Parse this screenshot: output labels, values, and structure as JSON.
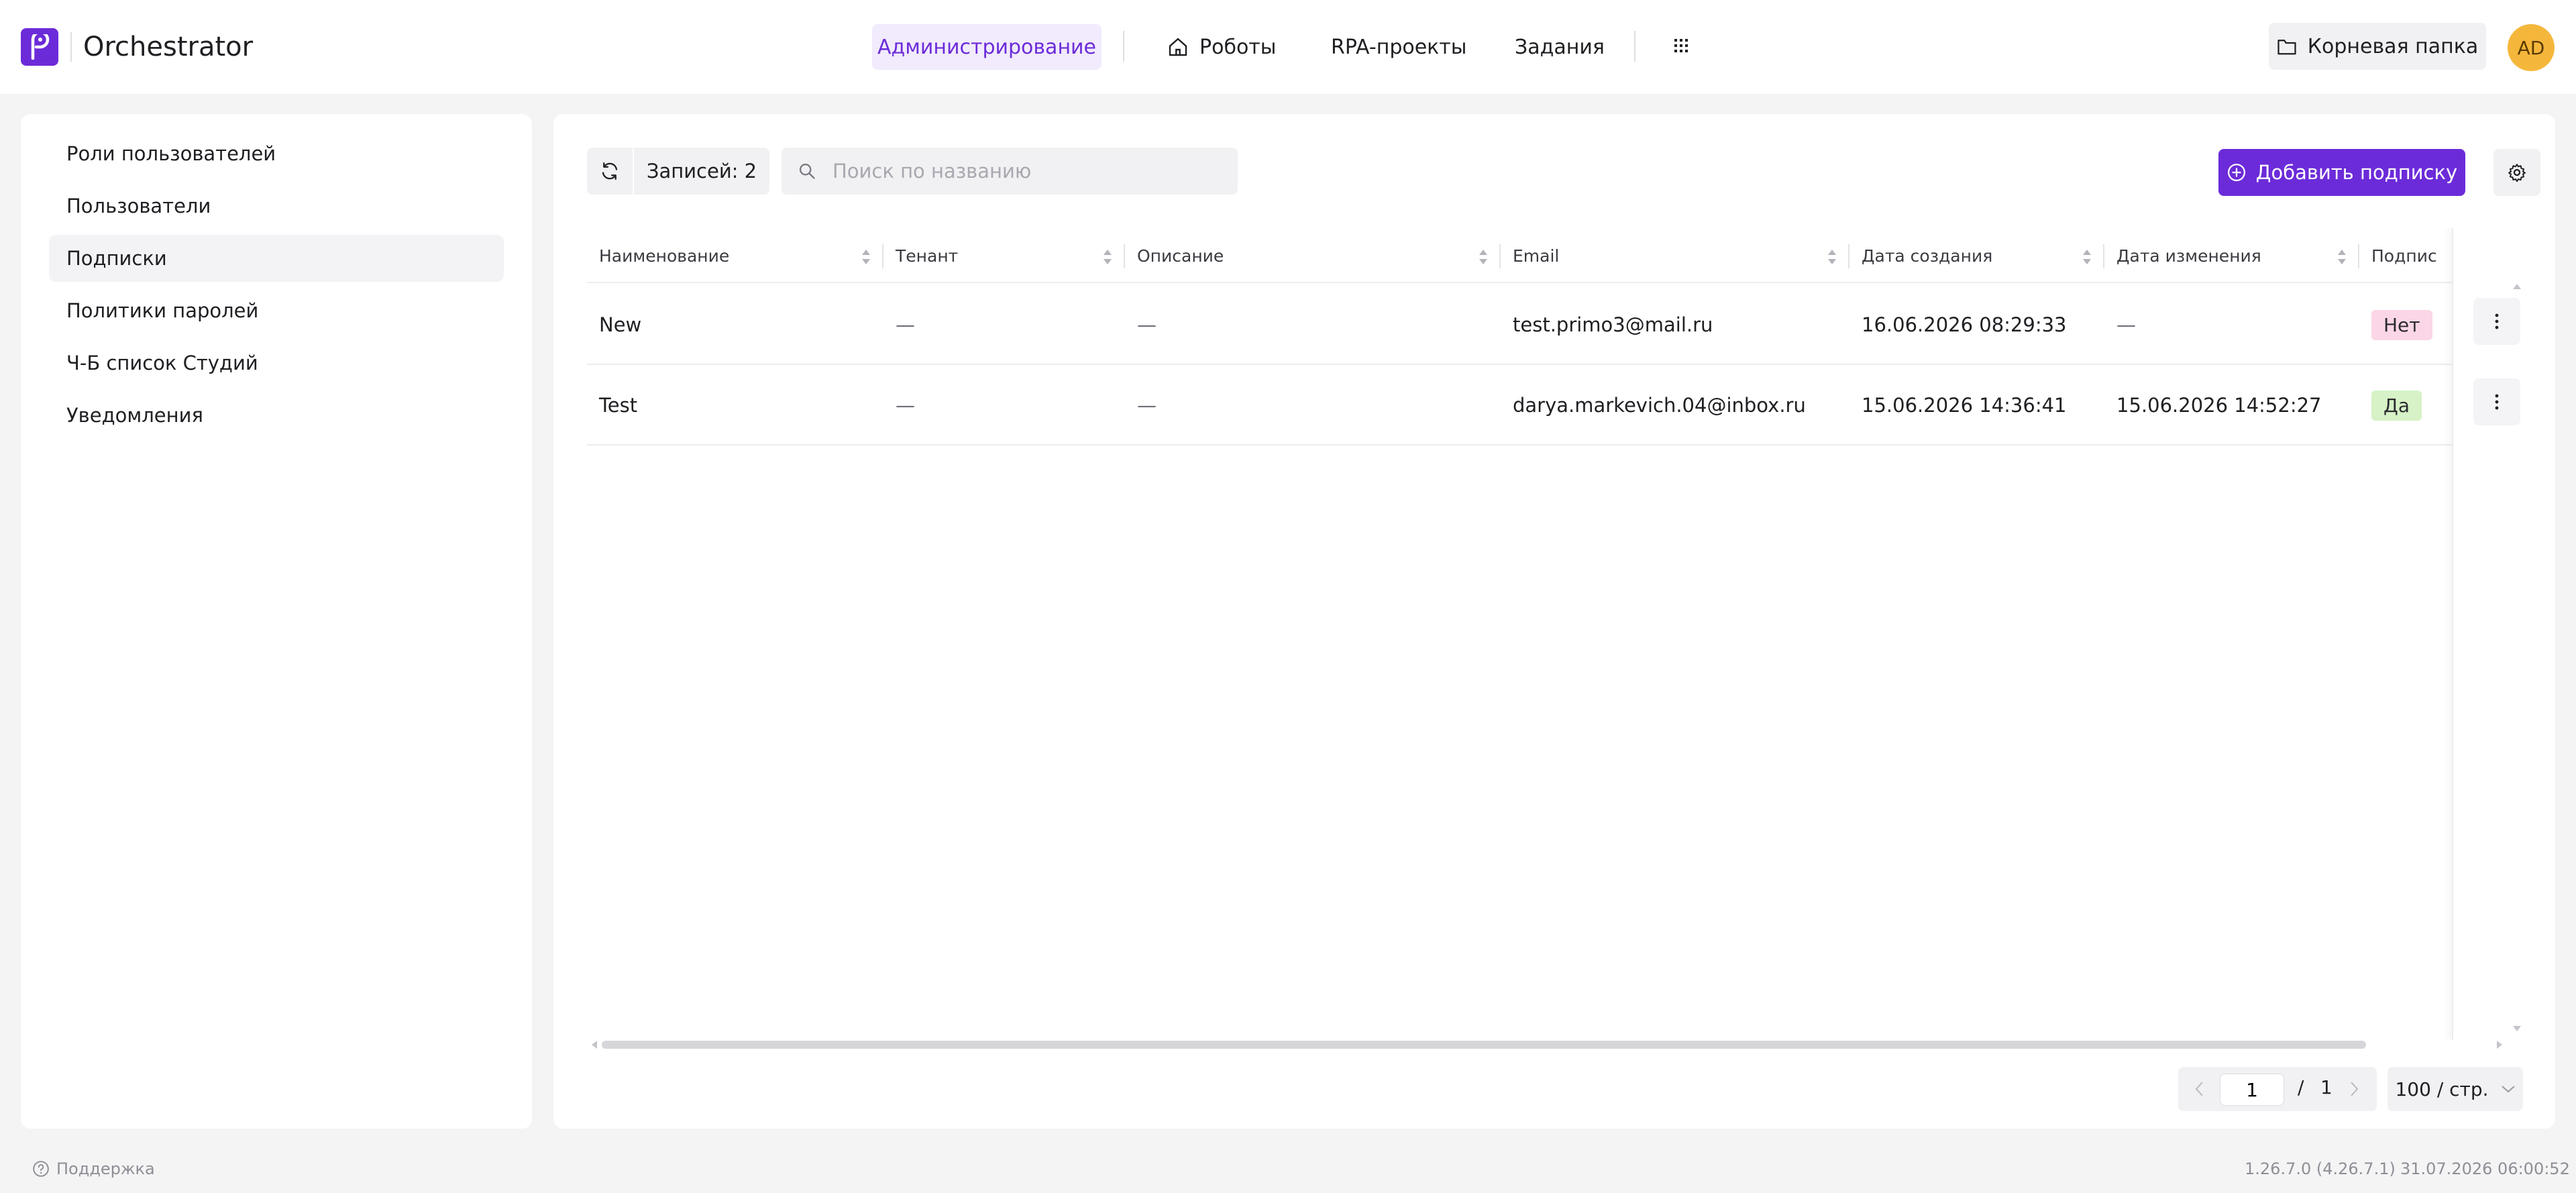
{
  "header": {
    "app_title": "Orchestrator",
    "nav": {
      "admin": "Администрирование",
      "robots": "Роботы",
      "rpa_projects": "RPA-проекты",
      "tasks": "Задания"
    },
    "root_folder": "Корневая папка",
    "avatar_initials": "AD"
  },
  "sidebar": {
    "items": [
      {
        "label": "Роли пользователей",
        "active": false
      },
      {
        "label": "Пользователи",
        "active": false
      },
      {
        "label": "Подписки",
        "active": true
      },
      {
        "label": "Политики паролей",
        "active": false
      },
      {
        "label": "Ч-Б список Студий",
        "active": false
      },
      {
        "label": "Уведомления",
        "active": false
      }
    ]
  },
  "toolbar": {
    "records_label": "Записей: 2",
    "search_placeholder": "Поиск по названию",
    "add_label": "Добавить подписку"
  },
  "table": {
    "columns": [
      "Наименование",
      "Тенант",
      "Описание",
      "Email",
      "Дата создания",
      "Дата изменения",
      "Подпис"
    ],
    "rows": [
      {
        "name": "New",
        "tenant": "—",
        "description": "—",
        "email": "test.primo3@mail.ru",
        "created": "16.06.2026 08:29:33",
        "modified": "—",
        "subscribed": "Нет"
      },
      {
        "name": "Test",
        "tenant": "—",
        "description": "—",
        "email": "darya.markevich.04@inbox.ru",
        "created": "15.06.2026 14:36:41",
        "modified": "15.06.2026 14:52:27",
        "subscribed": "Да"
      }
    ]
  },
  "pagination": {
    "current_page": "1",
    "separator": "/",
    "total_pages": "1",
    "per_page": "100 / стр."
  },
  "footer": {
    "support": "Поддержка",
    "version": "1.26.7.0 (4.26.7.1)",
    "datetime": "31.07.2026 06:00:52"
  },
  "colors": {
    "accent": "#6c2bd9",
    "accent_light": "#f1ebfd",
    "avatar": "#f5b73b",
    "badge_no": "#fbd6e6",
    "badge_yes": "#d6f2c6"
  }
}
